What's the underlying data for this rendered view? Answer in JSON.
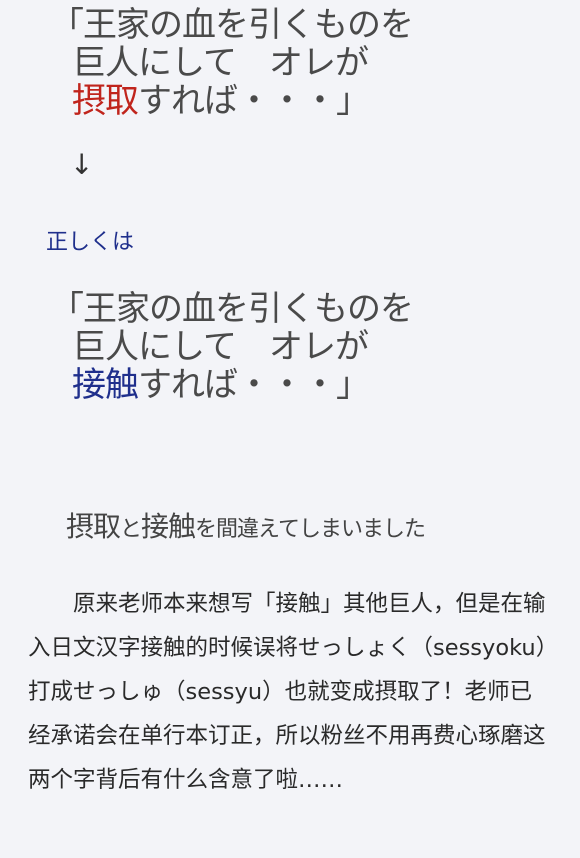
{
  "top_quote": {
    "line1": "「王家の血を引くものを",
    "line2": "巨人にして　オレが",
    "line3_highlight": "摂取",
    "line3_rest": "すれば・・・」"
  },
  "arrow": "↓",
  "correct_label": "正しくは",
  "bottom_quote": {
    "line1": "「王家の血を引くものを",
    "line2": "巨人にして　オレが",
    "line3_highlight": "接触",
    "line3_rest": "すれば・・・」"
  },
  "mistake_note": {
    "word1": "摂取",
    "to": "と",
    "word2": "接触",
    "rest": "を間違えてしまいました"
  },
  "body_text": "　　原来老师本来想写「接触」其他巨人，但是在输入日文汉字接触的时候误将せっしょく（sessyoku）打成せっしゅ（sessyu）也就变成摂取了！老师已经承诺会在单行本订正，所以粉丝不用再费心琢磨这两个字背后有什么含意了啦……"
}
